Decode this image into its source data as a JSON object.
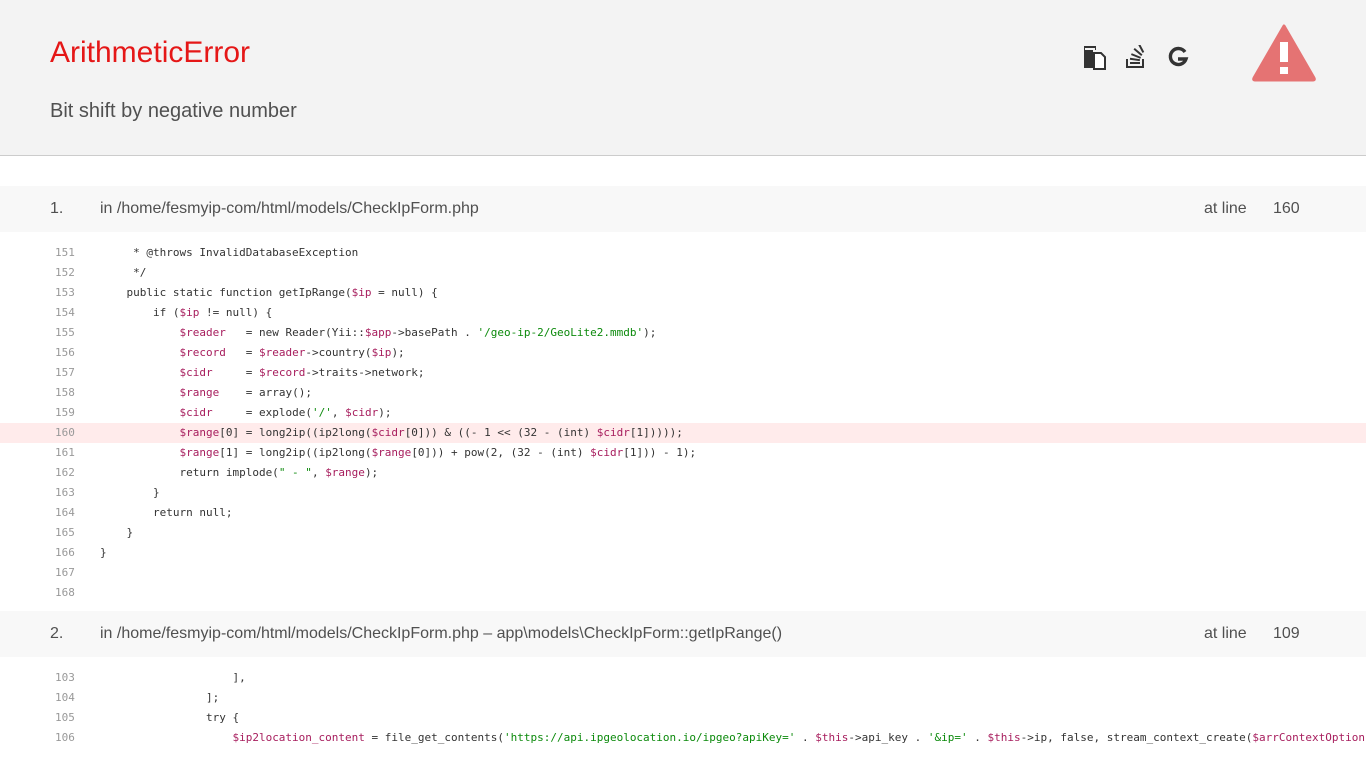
{
  "header": {
    "title": "ArithmeticError",
    "message": "Bit shift by negative number",
    "tools": [
      {
        "name": "copy-icon",
        "label": "Copy"
      },
      {
        "name": "stackoverflow-icon",
        "label": "Search Stack Overflow"
      },
      {
        "name": "google-icon",
        "label": "Search Google"
      }
    ],
    "alert_color": "#e57373"
  },
  "frames": [
    {
      "num": "1.",
      "location": "in /home/fesmyip-com/html/models/CheckIpForm.php",
      "at_line_label": "at line",
      "line": "160",
      "error_line": "160",
      "lines": [
        {
          "n": "151",
          "code": "     * @throws InvalidDatabaseException"
        },
        {
          "n": "152",
          "code": "     */"
        },
        {
          "n": "153",
          "code": "    public static function getIpRange($ip = null) {"
        },
        {
          "n": "154",
          "code": "        if ($ip != null) {"
        },
        {
          "n": "155",
          "code": "            $reader   = new Reader(Yii::$app->basePath . '/geo-ip-2/GeoLite2.mmdb');"
        },
        {
          "n": "156",
          "code": "            $record   = $reader->country($ip);"
        },
        {
          "n": "157",
          "code": "            $cidr     = $record->traits->network;"
        },
        {
          "n": "158",
          "code": "            $range    = array();"
        },
        {
          "n": "159",
          "code": "            $cidr     = explode('/', $cidr);"
        },
        {
          "n": "160",
          "code": "            $range[0] = long2ip((ip2long($cidr[0])) & ((- 1 << (32 - (int) $cidr[1]))));"
        },
        {
          "n": "161",
          "code": "            $range[1] = long2ip((ip2long($range[0])) + pow(2, (32 - (int) $cidr[1])) - 1);"
        },
        {
          "n": "162",
          "code": "            return implode(\" - \", $range);"
        },
        {
          "n": "163",
          "code": "        }"
        },
        {
          "n": "164",
          "code": "        return null;"
        },
        {
          "n": "165",
          "code": "    }"
        },
        {
          "n": "166",
          "code": "}"
        },
        {
          "n": "167",
          "code": ""
        },
        {
          "n": "168",
          "code": ""
        }
      ]
    },
    {
      "num": "2.",
      "location": "in /home/fesmyip-com/html/models/CheckIpForm.php – app\\models\\CheckIpForm::getIpRange()",
      "at_line_label": "at line",
      "line": "109",
      "error_line": "",
      "lines": [
        {
          "n": "103",
          "code": "                    ],"
        },
        {
          "n": "104",
          "code": "                ];"
        },
        {
          "n": "105",
          "code": "                try {"
        },
        {
          "n": "106",
          "code": "                    $ip2location_content = file_get_contents('https://api.ipgeolocation.io/ipgeo?apiKey=' . $this->api_key . '&ip=' . $this->ip, false, stream_context_create($arrContextOptions));"
        }
      ]
    }
  ]
}
